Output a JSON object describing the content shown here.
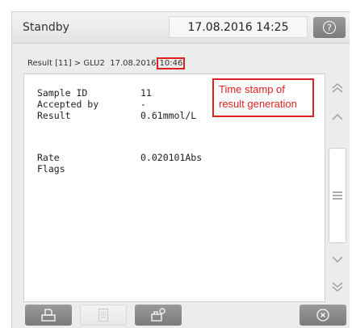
{
  "header": {
    "status": "Standby",
    "datetime": "17.08.2016 14:25",
    "help_icon": "help-icon"
  },
  "breadcrumb": {
    "prefix": "Result [11] > GLU2",
    "date": "17.08.2016",
    "time": "10:46"
  },
  "result": {
    "fields": [
      {
        "label": "Sample ID",
        "value": "11"
      },
      {
        "label": "Accepted by",
        "value": "-"
      },
      {
        "label": "Result",
        "value": "0.61mmol/L"
      },
      {
        "label": "Rate",
        "value": "0.020101Abs"
      },
      {
        "label": "Flags",
        "value": ""
      }
    ]
  },
  "annotation": {
    "line1": "Time stamp of",
    "line2": "result generation",
    "color": "#e02020"
  },
  "footer": {
    "icons": [
      "print-icon",
      "report-icon",
      "export-icon",
      "close-icon"
    ]
  }
}
